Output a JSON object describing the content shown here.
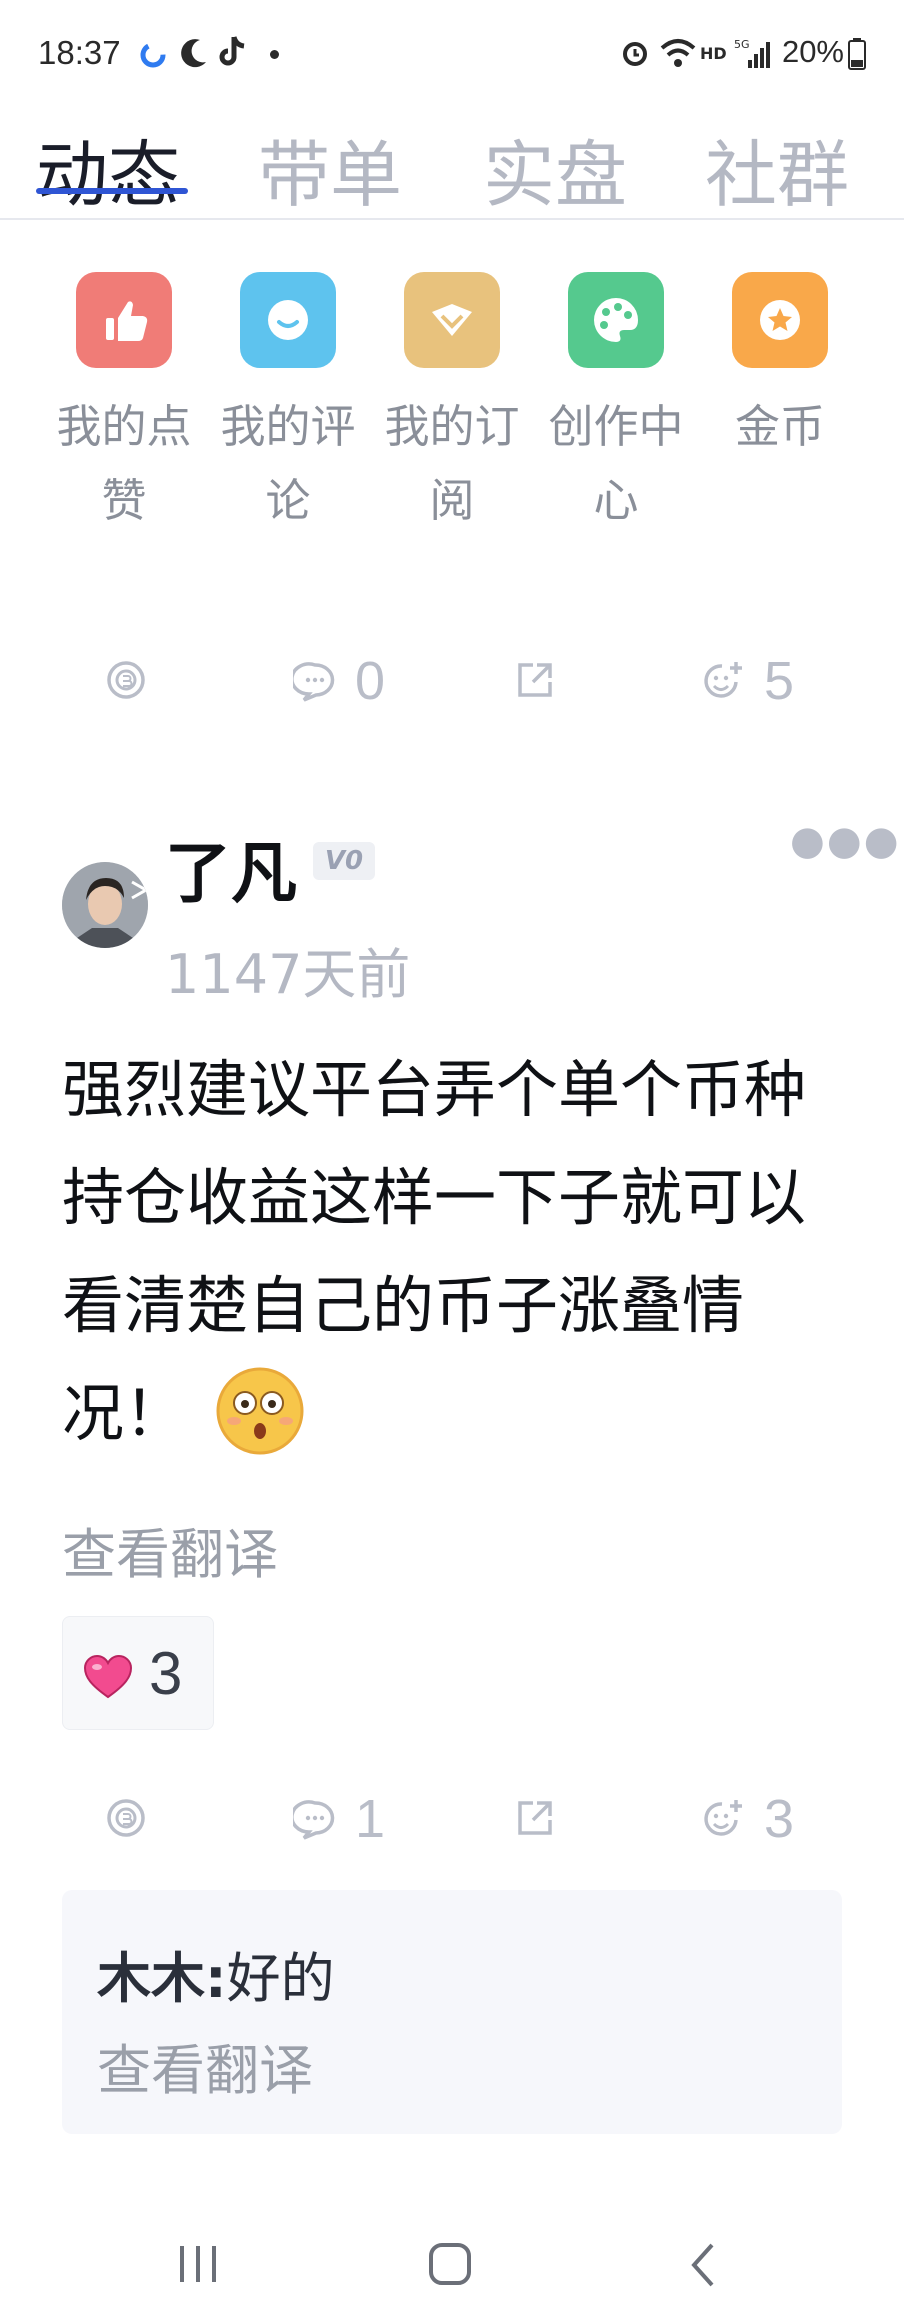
{
  "status_bar": {
    "time": "18:37",
    "battery": "20%",
    "icons": [
      "loading-icon",
      "moon-icon",
      "tiktok-icon",
      "dot-icon",
      "alarm-icon",
      "wifi-icon",
      "signal-icon",
      "battery-icon"
    ]
  },
  "tabs": [
    {
      "label": "动态",
      "active": true
    },
    {
      "label": "带单",
      "active": false
    },
    {
      "label": "实盘",
      "active": false
    },
    {
      "label": "社群",
      "active": false
    }
  ],
  "quick_menu": [
    {
      "label_line1": "我的点",
      "label_line2": "赞",
      "icon": "thumbs-up-icon",
      "color": "#f07c77"
    },
    {
      "label_line1": "我的评",
      "label_line2": "论",
      "icon": "comment-icon",
      "color": "#5ec3ee"
    },
    {
      "label_line1": "我的订",
      "label_line2": "阅",
      "icon": "subscribe-icon",
      "color": "#e8c27d"
    },
    {
      "label_line1": "创作中",
      "label_line2": "心",
      "icon": "palette-icon",
      "color": "#55c98e"
    },
    {
      "label_line1": "金币",
      "label_line2": "",
      "icon": "coin-icon",
      "color": "#f9a84a"
    }
  ],
  "action_row_1": {
    "comments": "0",
    "reactions": "5"
  },
  "post": {
    "author": "了凡",
    "badge": "V0",
    "time_ago": "1147天前",
    "text": "强烈建议平台弄个单个币种持仓收益这样一下子就可以看清楚自己的币子涨叠情况！",
    "translate": "查看翻译",
    "heart_count": "3",
    "comments": "1",
    "reactions": "3"
  },
  "comment": {
    "author": "木木:",
    "text": "好的",
    "translate": "查看翻译"
  },
  "colors": {
    "accent": "#2f55d4",
    "muted": "#b4b8c3"
  }
}
